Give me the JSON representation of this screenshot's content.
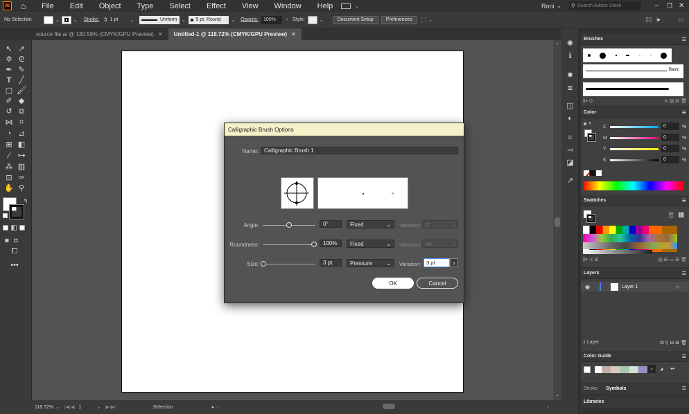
{
  "app": {
    "logo": "Ai",
    "user": "Roni",
    "search_placeholder": "Search Adobe Stock"
  },
  "menus": [
    "File",
    "Edit",
    "Object",
    "Type",
    "Select",
    "Effect",
    "View",
    "Window",
    "Help"
  ],
  "control_bar": {
    "selection": "No Selection",
    "stroke_label": "Stroke:",
    "stroke_value": "1 pt",
    "profile": "Uniform",
    "brush": "5 pt. Round",
    "opacity_label": "Opacity:",
    "opacity_value": "100%",
    "style_label": "Style:",
    "doc_setup": "Document Setup",
    "preferences": "Preferences"
  },
  "tabs": [
    {
      "label": "source file.ai @ 130.59% (CMYK/GPU Preview)",
      "active": false
    },
    {
      "label": "Untitled-1 @ 118.72% (CMYK/GPU Preview)",
      "active": true
    }
  ],
  "status": {
    "zoom": "118.72%",
    "artboard": "1",
    "tool": "Selection"
  },
  "panels": {
    "brushes": {
      "title": "Brushes",
      "basic": "Basic"
    },
    "color": {
      "title": "Color",
      "channels": [
        {
          "k": "C",
          "v": "0",
          "u": "%"
        },
        {
          "k": "M",
          "v": "0",
          "u": "%"
        },
        {
          "k": "Y",
          "v": "0",
          "u": "%"
        },
        {
          "k": "K",
          "v": "0",
          "u": "%"
        }
      ]
    },
    "swatches": {
      "title": "Swatches"
    },
    "layers": {
      "title": "Layers",
      "layer_name": "Layer 1",
      "count": "1 Layer"
    },
    "color_guide": {
      "title": "Color Guide"
    },
    "bottom_tabs": [
      "Stroke",
      "Symbols"
    ],
    "libraries": "Libraries"
  },
  "dialog": {
    "title": "Calligraphic Brush Options",
    "name_label": "Name:",
    "name_value": "Calligraphic Brush 1",
    "angle_label": "Angle:",
    "angle_value": "0°",
    "angle_mode": "Fixed",
    "roundness_label": "Roundness:",
    "roundness_value": "100%",
    "roundness_mode": "Fixed",
    "size_label": "Size:",
    "size_value": "3 pt",
    "size_mode": "Pressure",
    "variation_label": "Variation:",
    "angle_variation": "0°",
    "roundness_variation": "0%",
    "size_variation": "3 pt",
    "ok": "OK",
    "cancel": "Cancel"
  }
}
